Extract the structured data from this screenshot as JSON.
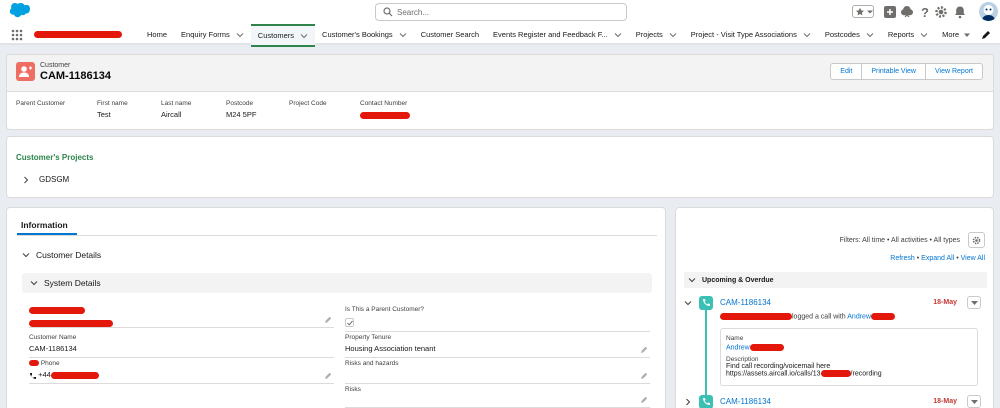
{
  "header": {
    "search_placeholder": "Search..."
  },
  "nav": {
    "tabs": [
      {
        "label": "Home",
        "dropdown": false
      },
      {
        "label": "Enquiry Forms",
        "dropdown": true
      },
      {
        "label": "Customers",
        "dropdown": true,
        "active": true
      },
      {
        "label": "Customer's Bookings",
        "dropdown": true
      },
      {
        "label": "Customer Search",
        "dropdown": false
      },
      {
        "label": "Events Register and Feedback F...",
        "dropdown": true
      },
      {
        "label": "Projects",
        "dropdown": true
      },
      {
        "label": "Project - Visit Type Associations",
        "dropdown": true
      },
      {
        "label": "Postcodes",
        "dropdown": true
      },
      {
        "label": "Reports",
        "dropdown": true
      },
      {
        "label": "More",
        "dropdown": true
      }
    ]
  },
  "record": {
    "type": "Customer",
    "title": "CAM-1186134",
    "buttons": {
      "edit": "Edit",
      "printable": "Printable View",
      "report": "View Report"
    },
    "fields": [
      {
        "label": "Parent Customer",
        "value": ""
      },
      {
        "label": "First name",
        "value": "Test"
      },
      {
        "label": "Last name",
        "value": "Aircall"
      },
      {
        "label": "Postcode",
        "value": "M24 5PF"
      },
      {
        "label": "Project Code",
        "value": ""
      },
      {
        "label": "Contact Number",
        "value": ""
      }
    ]
  },
  "projects": {
    "title": "Customer's Projects",
    "item": "GDSGM"
  },
  "info": {
    "tab": "Information",
    "customer_details": "Customer Details",
    "system_details": "System Details",
    "fields": {
      "parent_label": "Is This a Parent Customer?",
      "customer_name_label": "Customer Name",
      "customer_name_value": "CAM-1186134",
      "property_tenure_label": "Property Tenure",
      "property_tenure_value": "Housing Association tenant",
      "phone_label": "Phone",
      "phone_value": "+44",
      "risks_hazards_label": "Risks and hazards",
      "risks_label": "Risks"
    }
  },
  "activity": {
    "filters": "Filters: All time • All activities • All types",
    "links": {
      "refresh": "Refresh",
      "expand": "Expand All",
      "view": "View All"
    },
    "section": "Upcoming & Overdue",
    "items": [
      {
        "title": "CAM-1186134",
        "date": "18-May",
        "subject_suffix": "logged a call with",
        "subject_link": "Andrew",
        "name_label": "Name",
        "name_value": "Andrew",
        "desc_label": "Description",
        "desc_line1": "Find call recording/voicemail here",
        "desc_line2_prefix": "https://assets.aircall.io/calls/13",
        "desc_line2_suffix": "/recording"
      },
      {
        "title": "CAM-1186134",
        "date": "18-May"
      }
    ]
  }
}
